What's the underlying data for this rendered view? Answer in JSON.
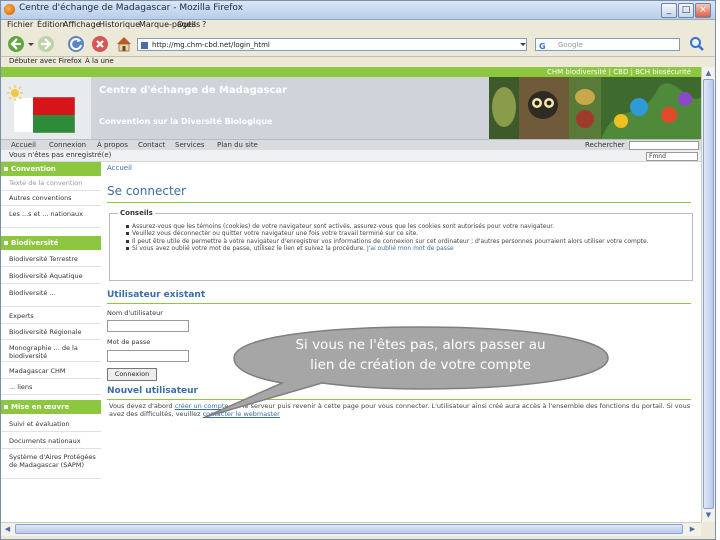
{
  "window": {
    "title": "Centre d'échange de Madagascar - Mozilla Firefox",
    "controls": [
      "_",
      "□",
      "×"
    ]
  },
  "menubar": [
    "Fichier",
    "Édition",
    "Affichage",
    "Historique",
    "Marque-pages",
    "Outils",
    "?"
  ],
  "toolbar": {
    "url": "http://mg.chm-cbd.net/login_html",
    "search_placeholder": "Google"
  },
  "bookmarks": [
    "Débuter avec Firefox",
    "À la une"
  ],
  "site": {
    "top_links": "CHM biodiversité  |  CBD  |  BCH biosécurité",
    "title": "Centre d'échange de Madagascar",
    "subtitle": "Convention sur la Diversité Biologique",
    "nav": [
      "Accueil",
      "Connexion",
      "À propos",
      "Contact",
      "Services",
      "Plan du site"
    ],
    "search_label": "Rechercher",
    "status": "Vous n'êtes pas enregistré(e)",
    "language": "Fmnd"
  },
  "sidebar": {
    "sections": [
      {
        "title": "Convention",
        "items": [
          "Texte de la convention",
          "Autres conventions",
          "Les ...s et ... nationaux"
        ]
      },
      {
        "title": "Biodiversité",
        "items": [
          "Biodiversité Terrestre",
          "Biodiversité Aquatique",
          "Biodiversité ...",
          "Experts",
          "Biodiversité Régionale",
          "Monographie ... de la biodiversité",
          "Madagascar CHM",
          "... liens"
        ]
      },
      {
        "title": "Mise en œuvre",
        "items": [
          "Suivi et évaluation",
          "Documents nationaux",
          "Système d'Aires Protégées de Madagascar (SAPM)"
        ]
      }
    ]
  },
  "main": {
    "breadcrumb": "Accueil",
    "heading": "Se connecter",
    "conseils_title": "Conseils",
    "conseils": [
      "Assurez-vous que les témoins (cookies) de votre navigateur sont activés, assurez-vous que les cookies sont autorisés pour votre navigateur.",
      "Veuillez vous déconnecter ou quitter votre navigateur une fois votre travail terminé sur ce site.",
      "Il peut être utile de permettre à votre navigateur d'enregistrer vos informations de connexion sur cet ordinateur ; d'autres personnes pourraient alors utiliser votre compte.",
      "Si vous avez oublié votre mot de passe, utilisez le lien et suivez la procédure."
    ],
    "conseil_link": "J'ai oublié mon mot de passe",
    "existing_heading": "Utilisateur existant",
    "username_label": "Nom d'utilisateur",
    "password_label": "Mot de passe",
    "login_button": "Connexion",
    "new_heading": "Nouvel utilisateur",
    "new_text_before": "Vous devez d'abord",
    "new_link": "créer un compte",
    "new_text_after": "sur le serveur puis revenir à cette page pour vous connecter. L'utilisateur ainsi créé aura accès à l'ensemble des fonctions du portail. Si vous avez des difficultés,",
    "webmaster_prefix": "veuillez",
    "webmaster_link": "contacter le webmaster"
  },
  "callout": {
    "text_line1": "Si vous ne l'êtes pas, alors passer au",
    "text_line2": "lien de création de votre compte",
    "fill": "#a6a6a6",
    "stroke": "#7f7f7f"
  },
  "colors": {
    "green": "#8dc63f",
    "link": "#3a6ea5",
    "banner": "#cfd4da"
  }
}
